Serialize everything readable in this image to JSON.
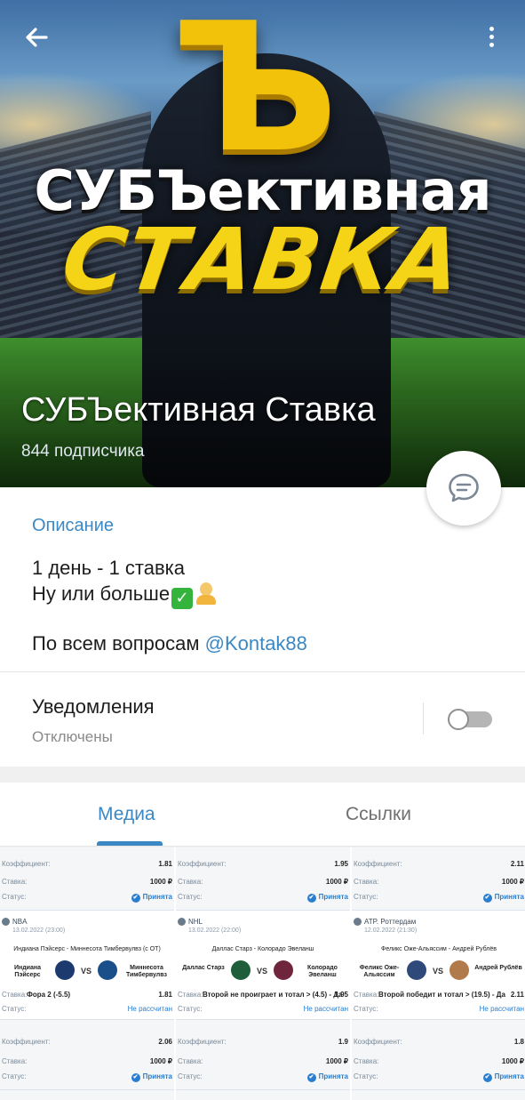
{
  "header": {
    "back_icon": "arrow-left-icon",
    "menu_icon": "more-vertical-icon",
    "logo_letter": "Ъ",
    "logo_line1": "СУБЪективная",
    "logo_line2": "СТАВКА",
    "channel_title": "СУБЪективная Ставка",
    "subscribers": "844 подписчика"
  },
  "fab": {
    "icon": "chat-bubble-icon"
  },
  "info": {
    "description_label": "Описание",
    "description_line1": "1 день - 1 ставка",
    "description_line2": "Ну или больше",
    "description_contact_prefix": "По всем вопросам ",
    "description_contact_link": "@Kontak88",
    "notifications_label": "Уведомления",
    "notifications_status": "Отключены",
    "notifications_enabled": false
  },
  "tabs": [
    {
      "label": "Медиа",
      "active": true
    },
    {
      "label": "Ссылки",
      "active": false
    }
  ],
  "media": [
    {
      "top": {
        "coef_label": "Коэффициент:",
        "coef": "1.81",
        "stake_label": "Ставка:",
        "stake": "1000 ₽",
        "status_label": "Статус:",
        "status": "Принята"
      },
      "card": {
        "league": "NBA",
        "date": "13.02.2022 (23:00)",
        "match": "Индиана Пэйсерс - Миннесота Тимбервулвз (с OT)",
        "team1": "Индиана Пэйсерс",
        "team2": "Миннесота Тимбервулвз",
        "vs": "VS",
        "bet_label": "Ставка:",
        "bet": "Фора 2 (-5.5)",
        "bet_coef": "1.81",
        "status_label": "Статус:",
        "status": "Не рассчитан",
        "color1": "#1d3a6e",
        "color2": "#1b4f8a"
      },
      "bottom": {
        "coef_label": "Коэффициент:",
        "coef": "2.06",
        "stake_label": "Ставка:",
        "stake": "1000 ₽",
        "status_label": "Статус:",
        "status": "Принята"
      }
    },
    {
      "top": {
        "coef_label": "Коэффициент:",
        "coef": "1.95",
        "stake_label": "Ставка:",
        "stake": "1000 ₽",
        "status_label": "Статус:",
        "status": "Принята"
      },
      "card": {
        "league": "NHL",
        "date": "13.02.2022 (22:00)",
        "match": "Даллас Старз - Колорадо Эвеланш",
        "team1": "Даллас Старз",
        "team2": "Колорадо Эвеланш",
        "vs": "VS",
        "bet_label": "Ставка:",
        "bet": "Второй не проиграет и тотал > (4.5) - Да",
        "bet_coef": "1.95",
        "status_label": "Статус:",
        "status": "Не рассчитан",
        "color1": "#1f5e3a",
        "color2": "#6f263d"
      },
      "bottom": {
        "coef_label": "Коэффициент:",
        "coef": "1.9",
        "stake_label": "Ставка:",
        "stake": "1000 ₽",
        "status_label": "Статус:",
        "status": "Принята"
      }
    },
    {
      "top": {
        "coef_label": "Коэффициент:",
        "coef": "2.11",
        "stake_label": "Ставка:",
        "stake": "1000 ₽",
        "status_label": "Статус:",
        "status": "Принята"
      },
      "card": {
        "league": "ATP. Роттердам",
        "date": "12.02.2022 (21:30)",
        "match": "Феликс Оже-Альяссим - Андрей Рублёв",
        "team1": "Феликс Оже-Альяссим",
        "team2": "Андрей Рублёв",
        "vs": "VS",
        "bet_label": "Ставка:",
        "bet": "Второй победит и тотал > (19.5) - Да",
        "bet_coef": "2.11",
        "status_label": "Статус:",
        "status": "Не рассчитан",
        "color1": "#2f4a7a",
        "color2": "#b07a4a"
      },
      "bottom": {
        "coef_label": "Коэффициент:",
        "coef": "1.8",
        "stake_label": "Ставка:",
        "stake": "1000 ₽",
        "status_label": "Статус:",
        "status": "Принята"
      }
    }
  ]
}
